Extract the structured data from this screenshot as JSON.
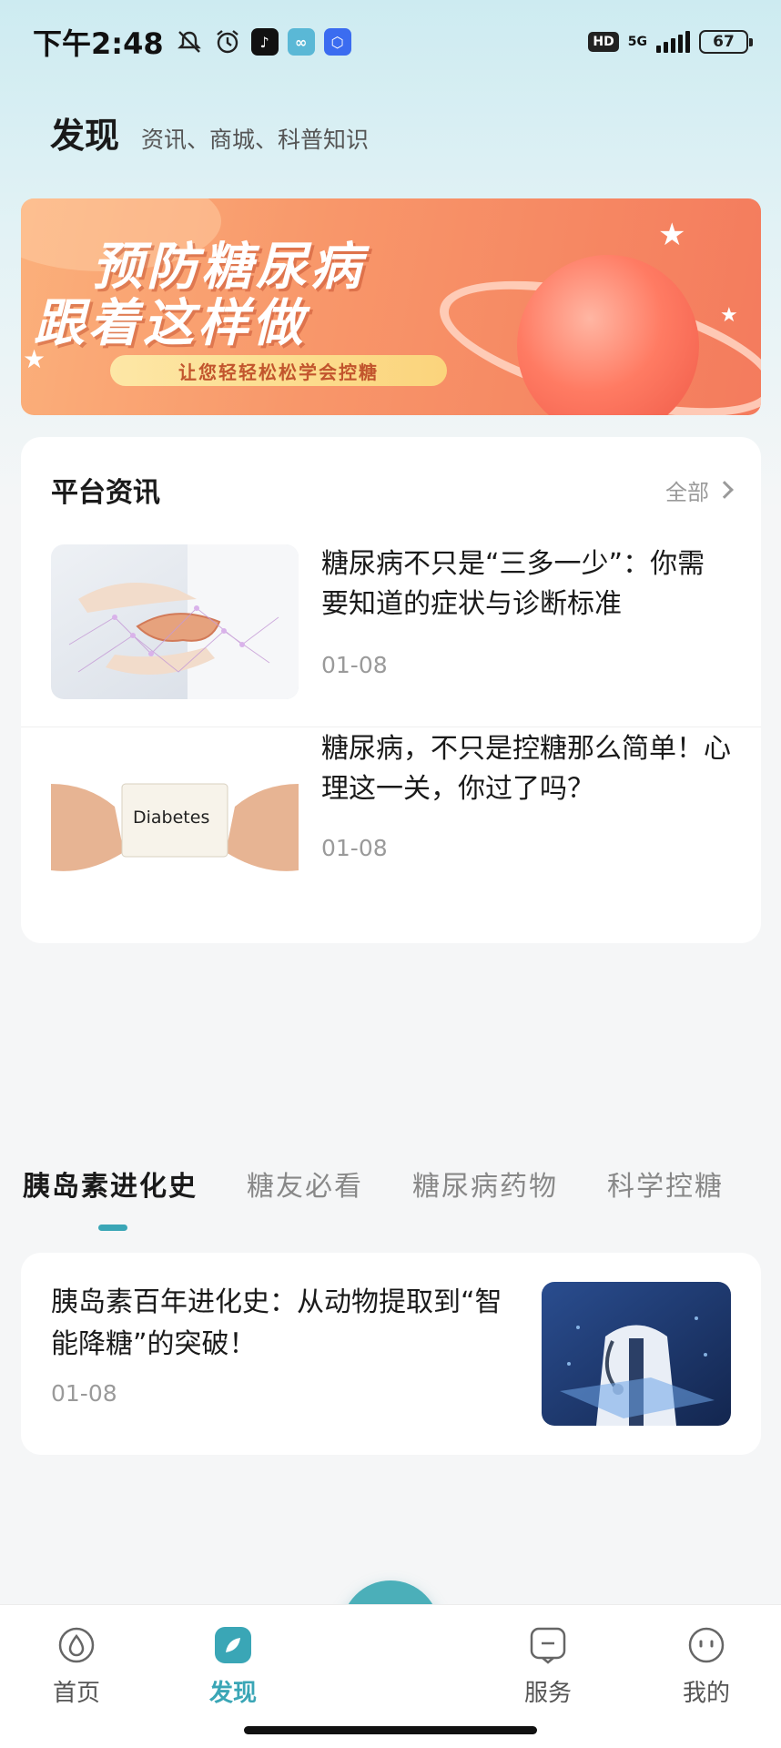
{
  "status_bar": {
    "time": "下午2:48",
    "hd": "HD",
    "network": "5G",
    "battery": "67",
    "icons": [
      "mute-bell-icon",
      "alarm-icon",
      "tiktok-icon",
      "app-icon",
      "app-icon"
    ]
  },
  "header": {
    "title": "发现",
    "subtitle": "资讯、商城、科普知识"
  },
  "banner": {
    "line1": "预防糖尿病",
    "line2": "跟着这样做",
    "tagline": "让您轻轻松松学会控糖"
  },
  "news": {
    "title": "平台资讯",
    "all_label": "全部",
    "items": [
      {
        "title": "糖尿病不只是“三多一少”：你需要知道的症状与诊断标准",
        "date": "01-08"
      },
      {
        "title": "糖尿病，不只是控糖那么简单！心理这一关，你过了吗？",
        "date": "01-08",
        "thumb_text": "Diabetes"
      }
    ]
  },
  "tabs": [
    {
      "label": "胰岛素进化史",
      "active": true
    },
    {
      "label": "糖友必看",
      "active": false
    },
    {
      "label": "糖尿病药物",
      "active": false
    },
    {
      "label": "科学控糖",
      "active": false
    }
  ],
  "article": {
    "title": "胰岛素百年进化史：从动物提取到“智能降糖”的突破！",
    "date": "01-08"
  },
  "bottom_nav": {
    "items": [
      {
        "label": "首页",
        "icon": "home-icon",
        "active": false
      },
      {
        "label": "发现",
        "icon": "discover-icon",
        "active": true
      },
      {
        "label": "服务",
        "icon": "service-icon",
        "active": false
      },
      {
        "label": "我的",
        "icon": "profile-icon",
        "active": false
      }
    ],
    "fab_icon": "plus-icon"
  },
  "colors": {
    "accent": "#3aa6b6",
    "fab": "#4bafb9",
    "banner_orange": "#f47b5d"
  }
}
